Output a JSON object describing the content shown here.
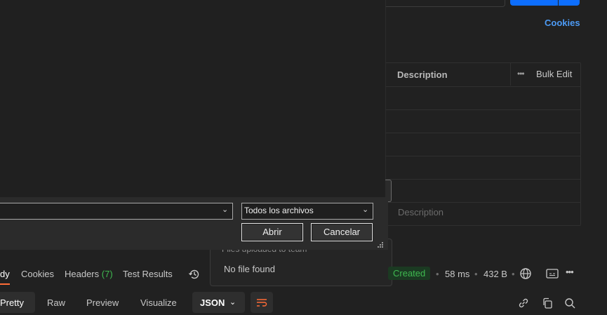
{
  "request": {
    "cookies_link": "Cookies"
  },
  "params_table": {
    "header_description": "Description",
    "bulk_edit_label": "Bulk Edit",
    "more_icon": "ellipsis-icon",
    "description_placeholder": "Description"
  },
  "files_popup": {
    "heading": "Files uploaded to team",
    "empty_text": "No file found"
  },
  "response_tabs": {
    "body_label": "dy",
    "cookies_label": "Cookies",
    "headers_label": "Headers",
    "headers_count": "(7)",
    "test_results_label": "Test Results"
  },
  "response_meta": {
    "status": "Created",
    "time": "58 ms",
    "size": "432 B"
  },
  "body_view": {
    "pretty_label": "Pretty",
    "raw_label": "Raw",
    "preview_label": "Preview",
    "visualize_label": "Visualize",
    "format_label": "JSON"
  },
  "file_dialog": {
    "filename_value": "",
    "filter_selected": "Todos los archivos",
    "open_label": "Abrir",
    "cancel_label": "Cancelar"
  },
  "colors": {
    "background": "#212121",
    "accent_blue": "#0d6efd",
    "link_blue": "#4d9bf5",
    "success_green": "#3fb950",
    "postman_orange": "#ff6c37"
  }
}
